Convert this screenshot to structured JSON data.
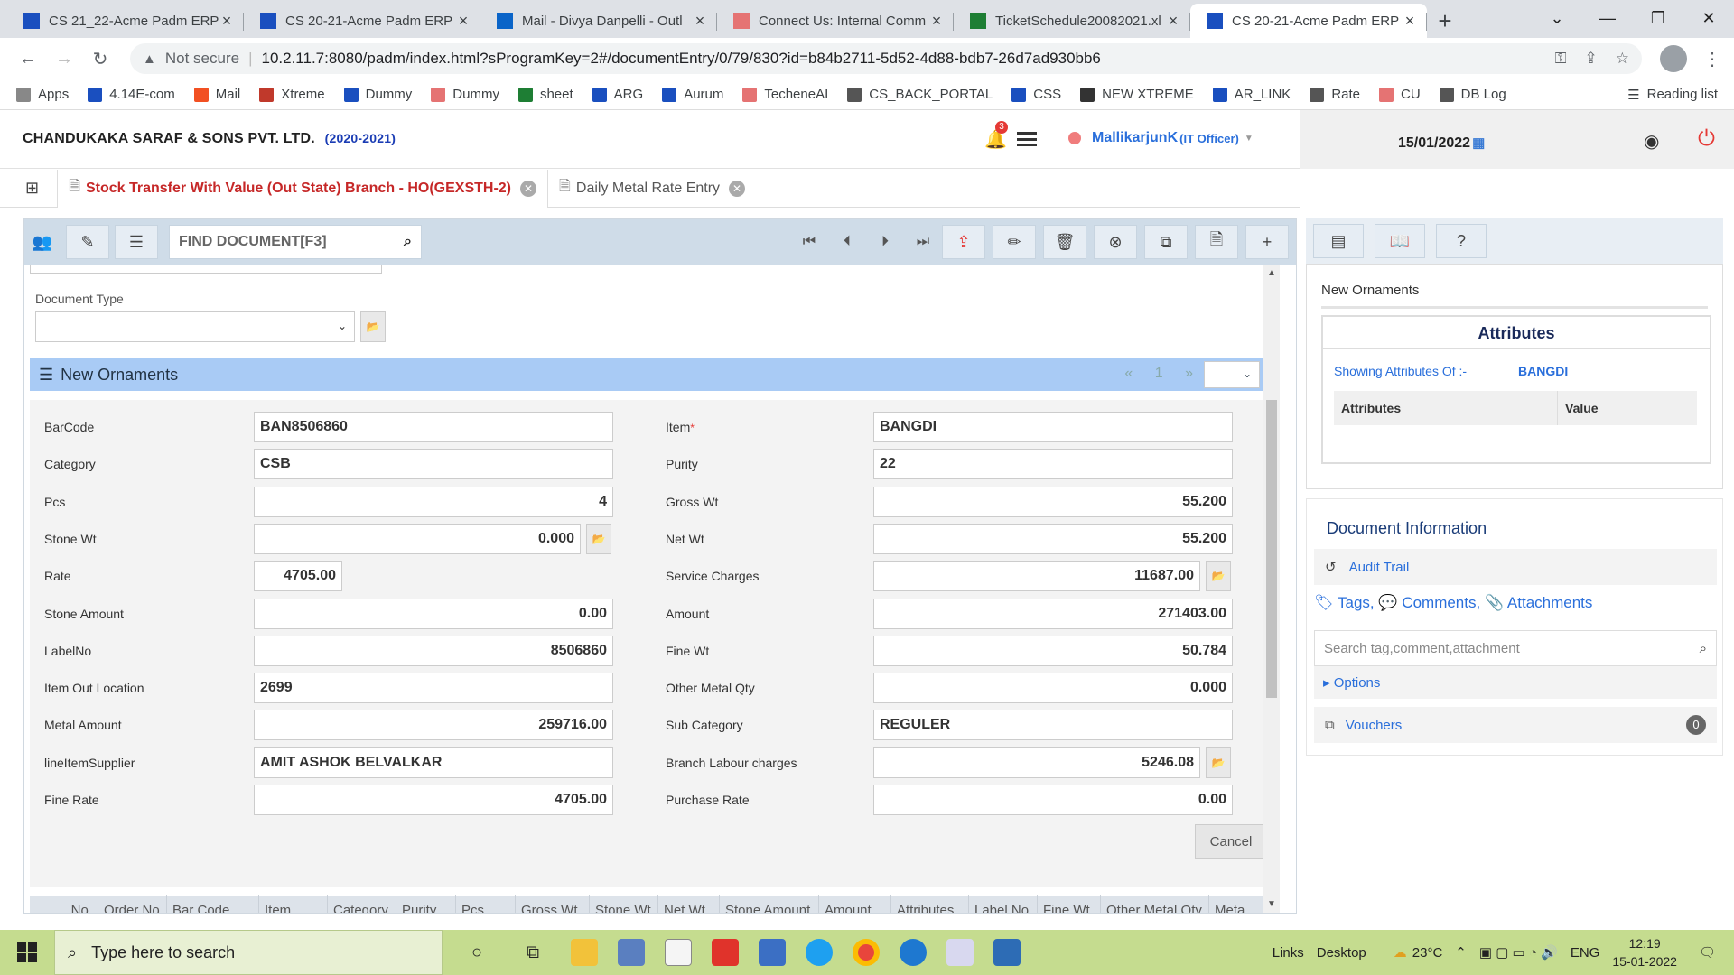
{
  "browser": {
    "tabs": [
      {
        "title": "CS 21_22-Acme Padm ERP",
        "active": false,
        "color": "#1a4fbf"
      },
      {
        "title": "CS 20-21-Acme Padm ERP",
        "active": false,
        "color": "#1a4fbf"
      },
      {
        "title": "Mail - Divya Danpelli - Outl",
        "active": false,
        "color": "#0a64c8"
      },
      {
        "title": "Connect Us: Internal Comm",
        "active": false,
        "color": "#e57373"
      },
      {
        "title": "TicketSchedule20082021.xl",
        "active": false,
        "color": "#1e7e34"
      },
      {
        "title": "CS 20-21-Acme Padm ERP",
        "active": true,
        "color": "#1a4fbf"
      }
    ],
    "security": "Not secure",
    "url": "10.2.11.7:8080/padm/index.html?sProgramKey=2#/documentEntry/0/79/830?id=b84b2711-5d52-4d88-bdb7-26d7ad930bb6",
    "bookmarks": [
      "Apps",
      "4.14E-com",
      "Mail",
      "Xtreme",
      "Dummy",
      "Dummy",
      "sheet",
      "ARG",
      "Aurum",
      "TecheneAI",
      "CS_BACK_PORTAL",
      "CSS",
      "NEW XTREME",
      "AR_LINK",
      "Rate",
      "CU",
      "DB Log"
    ],
    "reading_list": "Reading list"
  },
  "header": {
    "company": "CHANDUKAKA SARAF & SONS PVT. LTD.",
    "year": "(2020-2021)",
    "notif_count": "3",
    "user": "MallikarjunK",
    "role": "(IT Officer)",
    "date": "15/01/2022"
  },
  "subtabs": [
    {
      "label": "Stock Transfer With Value (Out State) Branch - HO(GEXSTH-2)",
      "active": true
    },
    {
      "label": "Daily Metal Rate Entry",
      "active": false
    }
  ],
  "toolbar": {
    "find_placeholder": "FIND DOCUMENT[F3]"
  },
  "form": {
    "doc_type_label": "Document Type",
    "section_title": "New Ornaments",
    "page": "1",
    "left": [
      {
        "label": "BarCode",
        "value": "BAN8506860",
        "align": "l"
      },
      {
        "label": "Category",
        "value": "CSB",
        "align": "l"
      },
      {
        "label": "Pcs",
        "value": "4",
        "align": "r"
      },
      {
        "label": "Stone Wt",
        "value": "0.000",
        "align": "r"
      },
      {
        "label": "Rate",
        "value": "4705.00",
        "align": "r"
      },
      {
        "label": "Stone Amount",
        "value": "0.00",
        "align": "r"
      },
      {
        "label": "LabelNo",
        "value": "8506860",
        "align": "r"
      },
      {
        "label": "Item Out Location",
        "value": "2699",
        "align": "l"
      },
      {
        "label": "Metal Amount",
        "value": "259716.00",
        "align": "r"
      },
      {
        "label": "lineItemSupplier",
        "value": "AMIT ASHOK BELVALKAR",
        "align": "l"
      },
      {
        "label": "Fine Rate",
        "value": "4705.00",
        "align": "r"
      }
    ],
    "right": [
      {
        "label": "Item",
        "value": "BANGDI",
        "align": "l"
      },
      {
        "label": "Purity",
        "value": "22",
        "align": "l"
      },
      {
        "label": "Gross Wt",
        "value": "55.200",
        "align": "r"
      },
      {
        "label": "Net Wt",
        "value": "55.200",
        "align": "r"
      },
      {
        "label": "Service Charges",
        "value": "11687.00",
        "align": "r"
      },
      {
        "label": "Amount",
        "value": "271403.00",
        "align": "r"
      },
      {
        "label": "Fine Wt",
        "value": "50.784",
        "align": "r"
      },
      {
        "label": "Other Metal Qty",
        "value": "0.000",
        "align": "r"
      },
      {
        "label": "Sub Category",
        "value": "REGULER",
        "align": "l"
      },
      {
        "label": "Branch Labour charges",
        "value": "5246.08",
        "align": "r"
      },
      {
        "label": "Purchase Rate",
        "value": "0.00",
        "align": "r"
      }
    ],
    "cancel_label": "Cancel",
    "table_headers": [
      "No.",
      "Order No",
      "Bar Code",
      "Item",
      "Category",
      "Purity",
      "Pcs",
      "Gross Wt",
      "Stone Wt",
      "Net Wt",
      "Stone Amount",
      "Amount",
      "Attributes",
      "Label No",
      "Fine Wt",
      "Other Metal Qty",
      "Meta"
    ]
  },
  "right_panel": {
    "card_title": "New Ornaments",
    "attributes_title": "Attributes",
    "showing_label": "Showing Attributes Of :-",
    "showing_value": "BANGDI",
    "col_attr": "Attributes",
    "col_value": "Value",
    "doc_info": "Document Information",
    "audit": "Audit Trail",
    "tags": "Tags,",
    "comments": "Comments,",
    "attachments": "Attachments",
    "search_placeholder": "Search tag,comment,attachment",
    "options": "Options",
    "vouchers": "Vouchers",
    "vouchers_count": "0"
  },
  "taskbar": {
    "search_placeholder": "Type here to search",
    "links": "Links",
    "desktop": "Desktop",
    "temp": "23°C",
    "lang": "ENG",
    "time": "12:19",
    "date": "15-01-2022"
  }
}
